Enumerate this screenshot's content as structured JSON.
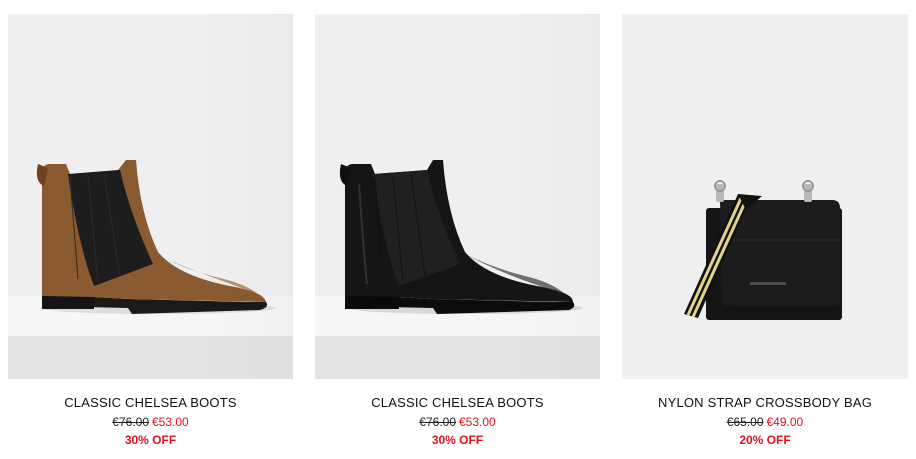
{
  "products": [
    {
      "name": "CLASSIC CHELSEA BOOTS",
      "old_price": "€76.00",
      "new_price": "€53.00",
      "discount": "30% OFF",
      "image_icon": "brown-suede-chelsea-boot",
      "color": "#8a5a30"
    },
    {
      "name": "CLASSIC CHELSEA BOOTS",
      "old_price": "€76.00",
      "new_price": "€53.00",
      "discount": "30% OFF",
      "image_icon": "black-leather-chelsea-boot",
      "color": "#141414"
    },
    {
      "name": "NYLON STRAP CROSSBODY BAG",
      "old_price": "€65.00",
      "new_price": "€49.00",
      "discount": "20% OFF",
      "image_icon": "black-crossbody-bag",
      "color": "#111111"
    }
  ],
  "theme": {
    "sale_color": "#e0121e",
    "image_background": "#efefef"
  }
}
